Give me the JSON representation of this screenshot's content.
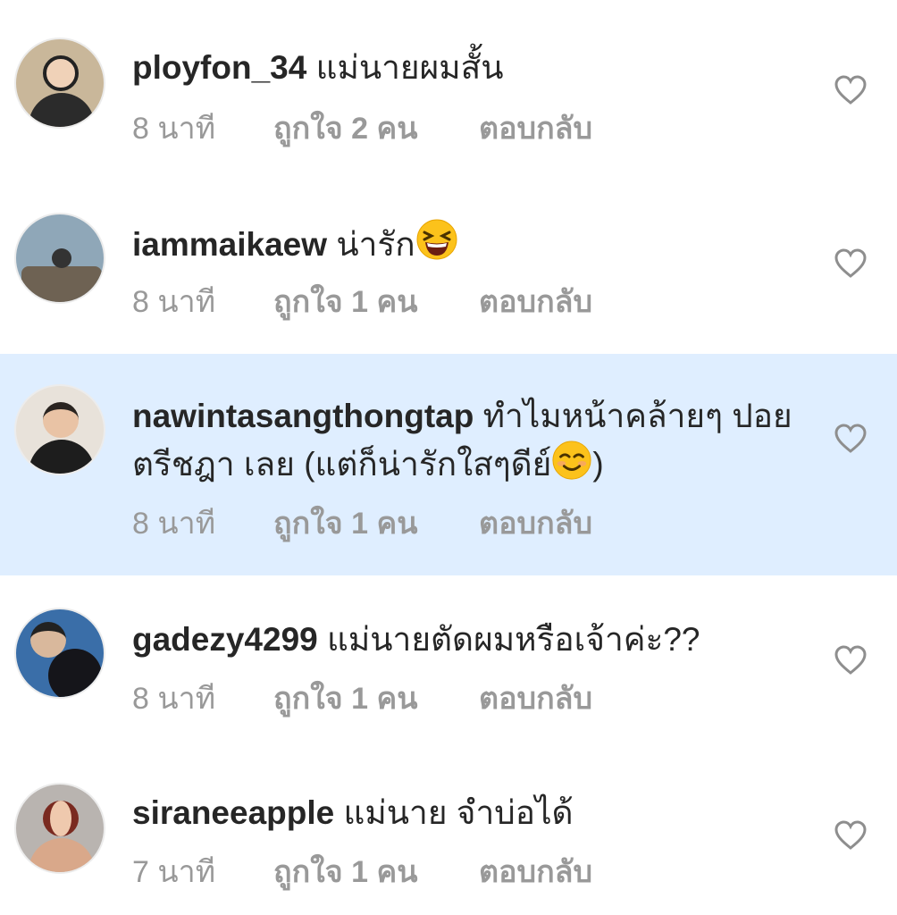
{
  "comments": [
    {
      "username": "ployfon_34",
      "text": "แม่นายผมสั้น",
      "time": "8 นาที",
      "likes": "ถูกใจ 2 คน",
      "reply": "ตอบกลับ",
      "avatar_icon": "avatar-woman-glasses",
      "emoji": ""
    },
    {
      "username": "iammaikaew",
      "text": "น่ารัก",
      "time": "8 นาที",
      "likes": "ถูกใจ 1 คน",
      "reply": "ตอบกลับ",
      "avatar_icon": "avatar-person-on-bridge",
      "emoji": "laughing-face"
    },
    {
      "username": "nawintasangthongtap",
      "text": "ทำไมหน้าคล้ายๆ ปอย ตรีชฎา เลย (แต่ก็น่ารักใสๆดีย์",
      "text_end": ")",
      "time": "8 นาที",
      "likes": "ถูกใจ 1 คน",
      "reply": "ตอบกลับ",
      "avatar_icon": "avatar-man",
      "emoji": "smiling-face",
      "highlighted": true
    },
    {
      "username": "gadezy4299",
      "text": "แม่นายตัดผมหรือเจ้าค่ะ??",
      "time": "8 นาที",
      "likes": "ถูกใจ 1 คน",
      "reply": "ตอบกลับ",
      "avatar_icon": "avatar-person-with-cat",
      "emoji": ""
    },
    {
      "username": "siraneeapple",
      "text": "แม่นาย จำบ่อได้",
      "time": "7 นาที",
      "likes": "ถูกใจ 1 คน",
      "reply": "ตอบกลับ",
      "avatar_icon": "avatar-woman",
      "emoji": ""
    }
  ],
  "colors": {
    "highlight": "#dfeeff",
    "meta_text": "#999999",
    "username": "#262626"
  }
}
